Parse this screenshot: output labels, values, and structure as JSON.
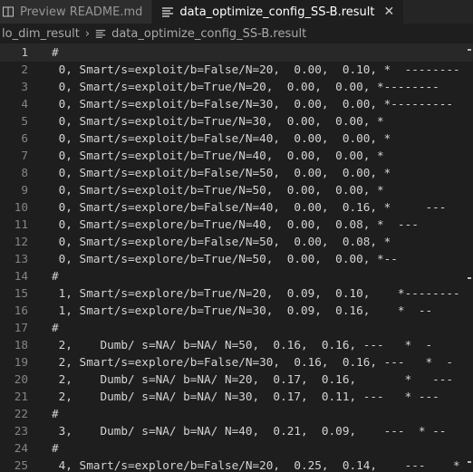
{
  "tabs": [
    {
      "label": "Preview README.md",
      "icon": "preview-icon",
      "active": false
    },
    {
      "label": "data_optimize_config_SS-B.result",
      "icon": "file-lines-icon",
      "active": true,
      "close": "✕"
    }
  ],
  "breadcrumb": {
    "folder": "lo_dim_result",
    "separator": "›",
    "file": "data_optimize_config_SS-B.result"
  },
  "lines": [
    {
      "n": "1",
      "text": "#"
    },
    {
      "n": "2",
      "text": " 0, Smart/s=exploit/b=False/N=20,  0.00,  0.10, *  --------"
    },
    {
      "n": "3",
      "text": " 0, Smart/s=exploit/b=True/N=20,  0.00,  0.00, *--------"
    },
    {
      "n": "4",
      "text": " 0, Smart/s=exploit/b=False/N=30,  0.00,  0.00, *---------"
    },
    {
      "n": "5",
      "text": " 0, Smart/s=exploit/b=True/N=30,  0.00,  0.00, *"
    },
    {
      "n": "6",
      "text": " 0, Smart/s=exploit/b=False/N=40,  0.00,  0.00, *"
    },
    {
      "n": "7",
      "text": " 0, Smart/s=exploit/b=True/N=40,  0.00,  0.00, *"
    },
    {
      "n": "8",
      "text": " 0, Smart/s=exploit/b=False/N=50,  0.00,  0.00, *"
    },
    {
      "n": "9",
      "text": " 0, Smart/s=exploit/b=True/N=50,  0.00,  0.00, *"
    },
    {
      "n": "10",
      "text": " 0, Smart/s=explore/b=False/N=40,  0.00,  0.16, *     ---"
    },
    {
      "n": "11",
      "text": " 0, Smart/s=explore/b=True/N=40,  0.00,  0.08, *  ---"
    },
    {
      "n": "12",
      "text": " 0, Smart/s=explore/b=False/N=50,  0.00,  0.08, *"
    },
    {
      "n": "13",
      "text": " 0, Smart/s=explore/b=True/N=50,  0.00,  0.00, *--"
    },
    {
      "n": "14",
      "text": "#"
    },
    {
      "n": "15",
      "text": " 1, Smart/s=explore/b=True/N=20,  0.09,  0.10,    *--------"
    },
    {
      "n": "16",
      "text": " 1, Smart/s=explore/b=True/N=30,  0.09,  0.16,    *  --"
    },
    {
      "n": "17",
      "text": "#"
    },
    {
      "n": "18",
      "text": " 2,    Dumb/ s=NA/ b=NA/ N=50,  0.16,  0.16, ---   *  -"
    },
    {
      "n": "19",
      "text": " 2, Smart/s=explore/b=False/N=30,  0.16,  0.16, ---   *  -"
    },
    {
      "n": "20",
      "text": " 2,    Dumb/ s=NA/ b=NA/ N=20,  0.17,  0.16,       *   ---"
    },
    {
      "n": "21",
      "text": " 2,    Dumb/ s=NA/ b=NA/ N=30,  0.17,  0.11, ---   * ---"
    },
    {
      "n": "22",
      "text": "#"
    },
    {
      "n": "23",
      "text": " 3,    Dumb/ s=NA/ b=NA/ N=40,  0.21,  0.09,    ---  * --"
    },
    {
      "n": "24",
      "text": "#"
    },
    {
      "n": "25",
      "text": " 4, Smart/s=explore/b=False/N=20,  0.25,  0.14,    ---    *"
    }
  ],
  "colors": {
    "background": "#1e1e1e",
    "tabbar": "#252526",
    "text": "#d4d4d4",
    "line_numbers": "#858585"
  }
}
